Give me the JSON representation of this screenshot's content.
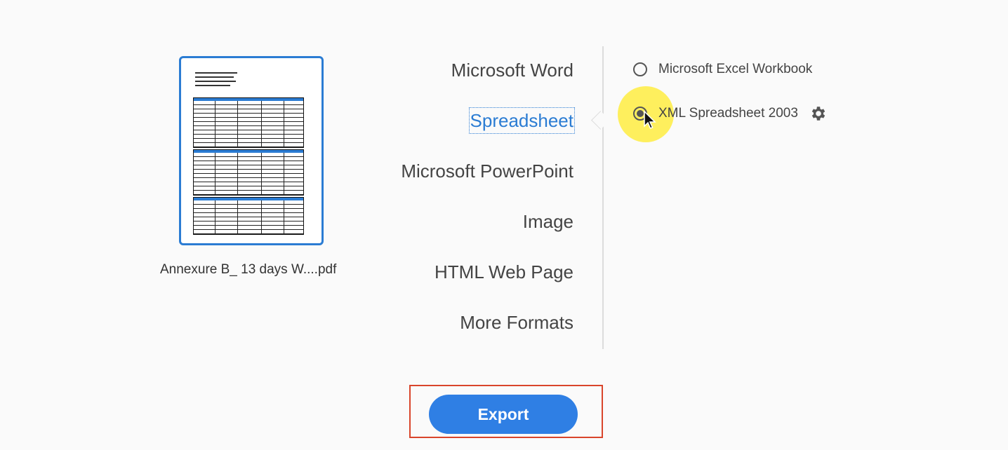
{
  "file": {
    "name": "Annexure B_ 13 days W....pdf"
  },
  "formats": [
    {
      "label": "Microsoft Word",
      "selected": false
    },
    {
      "label": "Spreadsheet",
      "selected": true
    },
    {
      "label": "Microsoft PowerPoint",
      "selected": false
    },
    {
      "label": "Image",
      "selected": false
    },
    {
      "label": "HTML Web Page",
      "selected": false
    },
    {
      "label": "More Formats",
      "selected": false
    }
  ],
  "spreadsheet_options": [
    {
      "label": "Microsoft Excel Workbook",
      "checked": false
    },
    {
      "label": "XML Spreadsheet 2003",
      "checked": true
    }
  ],
  "export": {
    "label": "Export"
  },
  "icons": {
    "settings": "gear-icon",
    "cursor": "mouse-pointer-icon"
  },
  "colors": {
    "accent": "#2b7cd3",
    "button": "#2f7fe4",
    "highlight_frame": "#d9452b",
    "cursor_halo": "#ffeb28"
  }
}
